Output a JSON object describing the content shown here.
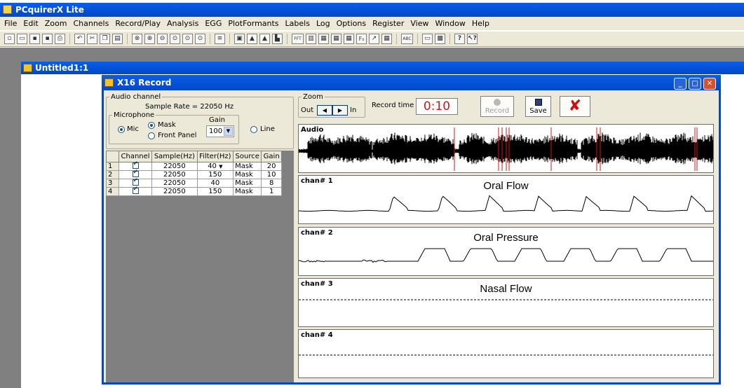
{
  "app": {
    "title": "PCquirerX Lite"
  },
  "menubar": [
    "File",
    "Edit",
    "Zoom",
    "Channels",
    "Record/Play",
    "Analysis",
    "EGG",
    "PlotFormants",
    "Labels",
    "Log",
    "Options",
    "Register",
    "View",
    "Window",
    "Help"
  ],
  "toolbar": {
    "icons": [
      "new-icon",
      "open-icon",
      "save-icon",
      "save-all-icon",
      "print-icon",
      "undo-icon",
      "cut-icon",
      "copy-icon",
      "paste-icon",
      "zoom-icon",
      "zoom-in-icon",
      "zoom-out-icon",
      "zoom-fit-icon",
      "zoom-full-icon",
      "zoom-sel-icon",
      "align-icon",
      "window-icon",
      "play-icon",
      "stop-icon",
      "rec-icon",
      "fft-icon",
      "spectrogram-icon",
      "spectrum-icon",
      "lpc-icon",
      "ltas-icon",
      "f0-icon",
      "pitch-icon",
      "table-icon",
      "label-icon",
      "notes-icon",
      "chart-icon",
      "help-icon",
      "whats-this-icon"
    ],
    "text_buttons": {
      "fft": "FFT",
      "f0": "F₀",
      "abc": "ABC"
    }
  },
  "document": {
    "title": "Untitled1:1"
  },
  "dialog": {
    "title": "X16 Record",
    "audio_channel": {
      "legend": "Audio channel",
      "sample_rate": "Sample Rate = 22050 Hz",
      "microphone_legend": "Microphone",
      "gain_label": "Gain",
      "gain_value": "100",
      "options": {
        "mic": "Mic",
        "mask": "Mask",
        "front_panel": "Front Panel",
        "line": "Line"
      },
      "selected": {
        "source": "Mic",
        "mic_input": "Mask"
      }
    },
    "channels_table": {
      "columns": [
        "Channel",
        "Sample(Hz)",
        "Filter(Hz)",
        "Source",
        "Gain"
      ],
      "rows": [
        {
          "n": "1",
          "checked": true,
          "sample": "22050",
          "filter": "40",
          "source": "Mask",
          "gain": "20"
        },
        {
          "n": "2",
          "checked": true,
          "sample": "22050",
          "filter": "150",
          "source": "Mask",
          "gain": "10"
        },
        {
          "n": "3",
          "checked": true,
          "sample": "22050",
          "filter": "40",
          "source": "Mask",
          "gain": "8"
        },
        {
          "n": "4",
          "checked": true,
          "sample": "22050",
          "filter": "150",
          "source": "Mask",
          "gain": "1"
        }
      ]
    },
    "zoom": {
      "legend": "Zoom",
      "out": "Out",
      "in": "In"
    },
    "record_time_label": "Record time",
    "record_time": "0:10",
    "record_button": "Record",
    "save_button": "Save",
    "channels": [
      {
        "label": "Audio",
        "title": ""
      },
      {
        "label": "chan# 1",
        "title": "Oral Flow"
      },
      {
        "label": "chan# 2",
        "title": "Oral Pressure"
      },
      {
        "label": "chan# 3",
        "title": "Nasal Flow"
      },
      {
        "label": "chan# 4",
        "title": ""
      }
    ],
    "colors": {
      "title_bar": "#0a5ee7",
      "dialog_bg": "#ece9d8",
      "timer_text": "#d0181c",
      "cancel_x": "#c81010",
      "clip_marker": "#e01010"
    }
  }
}
